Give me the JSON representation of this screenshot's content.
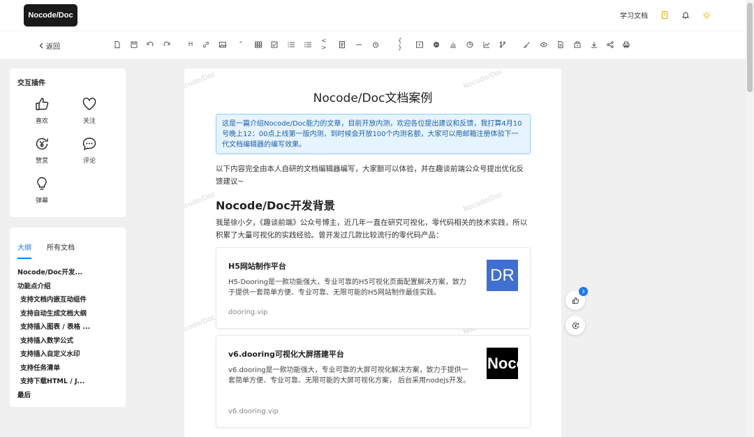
{
  "header": {
    "logo": "Nocode/Doc",
    "learn_docs": "学习文档"
  },
  "toolbar": {
    "back": "返回",
    "heading_glyph": "H",
    "quote_glyph": "”",
    "code_glyph": "< >",
    "brace_glyph": "{ }"
  },
  "plugins": {
    "title": "交互插件",
    "items": [
      {
        "label": "喜欢",
        "icon": "thumbs-up-icon"
      },
      {
        "label": "关注",
        "icon": "heart-icon"
      },
      {
        "label": "赞赏",
        "icon": "yuan-reward-icon"
      },
      {
        "label": "评论",
        "icon": "comment-icon"
      },
      {
        "label": "弹幕",
        "icon": "bulb-icon"
      }
    ]
  },
  "outline": {
    "tabs": [
      "大纲",
      "所有文档"
    ],
    "items": [
      {
        "label": "Nocode/Doc开发...",
        "sub": false
      },
      {
        "label": "功能点介绍",
        "sub": false
      },
      {
        "label": "支持文档内嵌互动组件",
        "sub": true
      },
      {
        "label": "支持自动生成文档大纲",
        "sub": true
      },
      {
        "label": "支持插入图表 / 表格 ...",
        "sub": true
      },
      {
        "label": "支持插入数学公式",
        "sub": true
      },
      {
        "label": "支持插入自定义水印",
        "sub": true
      },
      {
        "label": "支持任务清单",
        "sub": true
      },
      {
        "label": "支持下载HTML / J...",
        "sub": true
      },
      {
        "label": "最后",
        "sub": false
      }
    ]
  },
  "doc": {
    "watermark": "Nocode/Doc",
    "title": "Nocode/Doc文档案例",
    "notice": "这是一篇介绍Nocode/Doc能力的文章，目前开放内测，欢迎各位提出建议和反馈，我打算4月10号晚上12：00点上线第一版内测，到时候会开放100个内测名额，大家可以用邮箱注册体验下一代文档编辑器的编写效果。",
    "intro": "以下内容完全由本人自研的文档编辑器编写，大家额可以体验，并在趣谈前端公众号提出优化反馈建议~",
    "section_title": "Nocode/Doc开发背景",
    "section_para": "我是徐小夕，《趣谈前端》公众号博主，近几年一直在研究可视化，零代码相关的技术实践，所以积累了大量可视化的实践经验。曾开发过几款比较流行的零代码产品：",
    "cards": [
      {
        "title": "H5网站制作平台",
        "desc": "H5-Dooring是一款功能强大，专业可靠的H5可视化页面配置解决方案，致力于提供一套简单方便、专业可靠、无限可能的H5网站制作最佳实践。",
        "link": "dooring.vip",
        "logo_text": "DR",
        "logo_bg": "#3f6fd1"
      },
      {
        "title": "v6.dooring可视化大屏搭建平台",
        "desc": "v6.dooring是一款功能强大，专业可靠的大屏可视化解决方案，致力于提供一套简单方便、专业可靠、无限可能的大屏可视化方案， 后台采用nodejs开发。",
        "link": "v6.dooring.vip",
        "logo_text": "Noco",
        "logo_bg": "#000000"
      }
    ]
  },
  "float": {
    "like_count": "3"
  },
  "colors": {
    "accent": "#1677ff",
    "notice_bg": "#e6f4ff",
    "notice_border": "#91caff"
  }
}
